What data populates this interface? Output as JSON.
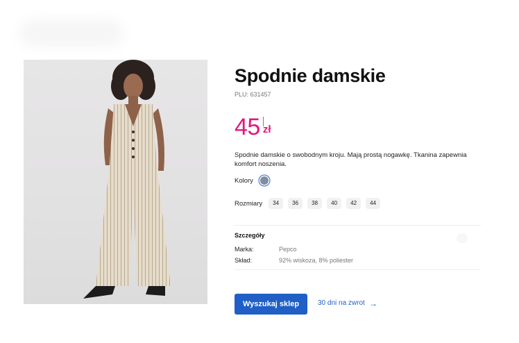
{
  "product": {
    "title": "Spodnie damskie",
    "plu": "PLU: 631457",
    "price_main": "45",
    "price_currency": "zł",
    "description": "Spodnie damskie o swobodnym kroju. Mają prostą nogawkę. Tkanina zapewnia komfort noszenia.",
    "colors_label": "Kolory",
    "color_swatch": "#7f8d9f",
    "sizes_label": "Rozmiary",
    "sizes": [
      "34",
      "36",
      "38",
      "40",
      "42",
      "44"
    ]
  },
  "details": {
    "title": "Szczegóły",
    "rows": [
      {
        "key": "Marka:",
        "value": "Pepco"
      },
      {
        "key": "Skład:",
        "value": "92% wiskoza, 8% poliester"
      }
    ]
  },
  "actions": {
    "search_store": "Wyszukaj sklep",
    "returns": "30 dni na zwrot",
    "returns_icon": "arrow-right-icon"
  },
  "colors": {
    "accent": "#1f5fc6",
    "price": "#e0197d"
  }
}
